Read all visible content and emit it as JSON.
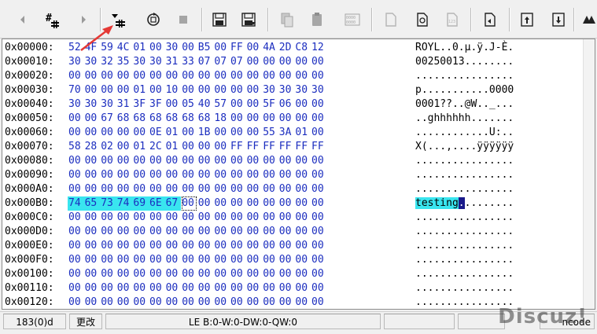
{
  "colors": {
    "hex_text": "#1b2dbf",
    "highlight": "#39e5ef",
    "cursor_bg": "#1a1a8a",
    "annotation_arrow": "#e53935"
  },
  "toolbar": {
    "icons": [
      "prev-arrow-icon",
      "hash-icon",
      "next-arrow-icon",
      "dropdown-plug-icon",
      "refresh-icon",
      "stop-icon",
      "save-icon",
      "save-as-icon",
      "copy-icon",
      "paste-icon",
      "hex-grid-icon",
      "new-doc-icon",
      "copy-doc-icon",
      "doc-number-icon",
      "doc-export-icon",
      "goto-top-icon",
      "goto-down-icon",
      "tool-icon"
    ]
  },
  "hex": {
    "rows": [
      {
        "addr": "0x00000:",
        "bytes": [
          "52",
          "4F",
          "59",
          "4C",
          "01",
          "00",
          "30",
          "00",
          "B5",
          "00",
          "FF",
          "00",
          "4A",
          "2D",
          "C8",
          "12"
        ],
        "ascii": "ROYL..0.µ.ÿ.J-È."
      },
      {
        "addr": "0x00010:",
        "bytes": [
          "30",
          "30",
          "32",
          "35",
          "30",
          "30",
          "31",
          "33",
          "07",
          "07",
          "07",
          "00",
          "00",
          "00",
          "00",
          "00"
        ],
        "ascii": "00250013........"
      },
      {
        "addr": "0x00020:",
        "bytes": [
          "00",
          "00",
          "00",
          "00",
          "00",
          "00",
          "00",
          "00",
          "00",
          "00",
          "00",
          "00",
          "00",
          "00",
          "00",
          "00"
        ],
        "ascii": "................"
      },
      {
        "addr": "0x00030:",
        "bytes": [
          "70",
          "00",
          "00",
          "00",
          "01",
          "00",
          "10",
          "00",
          "00",
          "00",
          "00",
          "00",
          "30",
          "30",
          "30",
          "30"
        ],
        "ascii": "p...........0000"
      },
      {
        "addr": "0x00040:",
        "bytes": [
          "30",
          "30",
          "30",
          "31",
          "3F",
          "3F",
          "00",
          "05",
          "40",
          "57",
          "00",
          "00",
          "5F",
          "06",
          "00",
          "00"
        ],
        "ascii": "0001??..@W.._..."
      },
      {
        "addr": "0x00050:",
        "bytes": [
          "00",
          "00",
          "67",
          "68",
          "68",
          "68",
          "68",
          "68",
          "68",
          "18",
          "00",
          "00",
          "00",
          "00",
          "00",
          "00"
        ],
        "ascii": "..ghhhhhh......."
      },
      {
        "addr": "0x00060:",
        "bytes": [
          "00",
          "00",
          "00",
          "00",
          "00",
          "0E",
          "01",
          "00",
          "1B",
          "00",
          "00",
          "00",
          "55",
          "3A",
          "01",
          "00"
        ],
        "ascii": "............U:.."
      },
      {
        "addr": "0x00070:",
        "bytes": [
          "58",
          "28",
          "02",
          "00",
          "01",
          "2C",
          "01",
          "00",
          "00",
          "00",
          "FF",
          "FF",
          "FF",
          "FF",
          "FF",
          "FF"
        ],
        "ascii": "X(...,....ÿÿÿÿÿÿ"
      },
      {
        "addr": "0x00080:",
        "bytes": [
          "00",
          "00",
          "00",
          "00",
          "00",
          "00",
          "00",
          "00",
          "00",
          "00",
          "00",
          "00",
          "00",
          "00",
          "00",
          "00"
        ],
        "ascii": "................"
      },
      {
        "addr": "0x00090:",
        "bytes": [
          "00",
          "00",
          "00",
          "00",
          "00",
          "00",
          "00",
          "00",
          "00",
          "00",
          "00",
          "00",
          "00",
          "00",
          "00",
          "00"
        ],
        "ascii": "................"
      },
      {
        "addr": "0x000A0:",
        "bytes": [
          "00",
          "00",
          "00",
          "00",
          "00",
          "00",
          "00",
          "00",
          "00",
          "00",
          "00",
          "00",
          "00",
          "00",
          "00",
          "00"
        ],
        "ascii": "................"
      },
      {
        "addr": "0x000B0:",
        "bytes": [
          "74",
          "65",
          "73",
          "74",
          "69",
          "6E",
          "67",
          "00",
          "00",
          "00",
          "00",
          "00",
          "00",
          "00",
          "00",
          "00"
        ],
        "ascii_hl": "testing",
        "ascii_cur": ".",
        "ascii_rest": "........"
      },
      {
        "addr": "0x000C0:",
        "bytes": [
          "00",
          "00",
          "00",
          "00",
          "00",
          "00",
          "00",
          "00",
          "00",
          "00",
          "00",
          "00",
          "00",
          "00",
          "00",
          "00"
        ],
        "ascii": "................"
      },
      {
        "addr": "0x000D0:",
        "bytes": [
          "00",
          "00",
          "00",
          "00",
          "00",
          "00",
          "00",
          "00",
          "00",
          "00",
          "00",
          "00",
          "00",
          "00",
          "00",
          "00"
        ],
        "ascii": "................"
      },
      {
        "addr": "0x000E0:",
        "bytes": [
          "00",
          "00",
          "00",
          "00",
          "00",
          "00",
          "00",
          "00",
          "00",
          "00",
          "00",
          "00",
          "00",
          "00",
          "00",
          "00"
        ],
        "ascii": "................"
      },
      {
        "addr": "0x000F0:",
        "bytes": [
          "00",
          "00",
          "00",
          "00",
          "00",
          "00",
          "00",
          "00",
          "00",
          "00",
          "00",
          "00",
          "00",
          "00",
          "00",
          "00"
        ],
        "ascii": "................"
      },
      {
        "addr": "0x00100:",
        "bytes": [
          "00",
          "00",
          "00",
          "00",
          "00",
          "00",
          "00",
          "00",
          "00",
          "00",
          "00",
          "00",
          "00",
          "00",
          "00",
          "00"
        ],
        "ascii": "................"
      },
      {
        "addr": "0x00110:",
        "bytes": [
          "00",
          "00",
          "00",
          "00",
          "00",
          "00",
          "00",
          "00",
          "00",
          "00",
          "00",
          "00",
          "00",
          "00",
          "00",
          "00"
        ],
        "ascii": "................"
      },
      {
        "addr": "0x00120:",
        "bytes": [
          "00",
          "00",
          "00",
          "00",
          "00",
          "00",
          "00",
          "00",
          "00",
          "00",
          "00",
          "00",
          "00",
          "00",
          "00",
          "00"
        ],
        "ascii": "................"
      }
    ],
    "highlight_row": 11,
    "highlight_count": 7,
    "cursor_index": 7
  },
  "status": {
    "offset": "183(0)d",
    "mode": "更改",
    "values": "LE B:0-W:0-DW:0-QW:0",
    "encoding": "ncode"
  },
  "watermark": "Discuz!"
}
